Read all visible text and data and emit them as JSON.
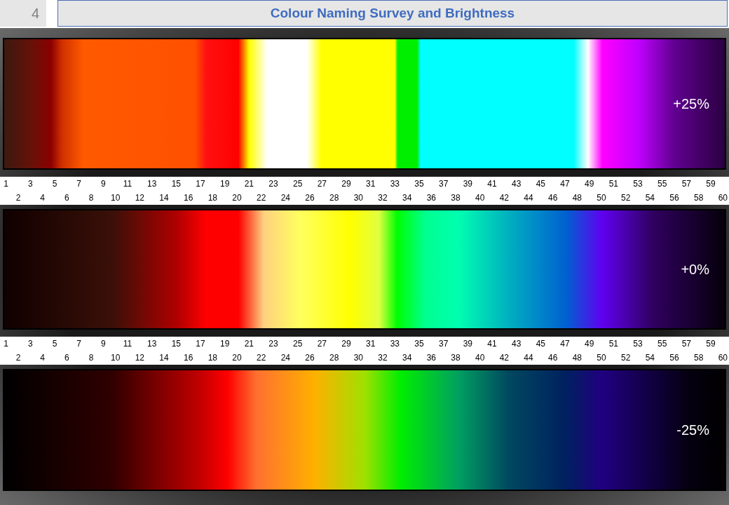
{
  "header": {
    "page_number": "4",
    "title": "Colour Naming Survey and Brightness"
  },
  "bands": [
    {
      "kind": "bright",
      "label": "+25%"
    },
    {
      "kind": "normal",
      "label": "+0%"
    },
    {
      "kind": "dark",
      "label": "-25%"
    }
  ],
  "scales": [
    {
      "ticks": [
        "1",
        "2",
        "3",
        "4",
        "5",
        "6",
        "7",
        "8",
        "9",
        "10",
        "11",
        "12",
        "13",
        "14",
        "15",
        "16",
        "17",
        "18",
        "19",
        "20",
        "21",
        "22",
        "23",
        "24",
        "25",
        "26",
        "27",
        "28",
        "29",
        "30",
        "31",
        "32",
        "33",
        "34",
        "35",
        "36",
        "37",
        "38",
        "39",
        "40",
        "41",
        "42",
        "43",
        "44",
        "45",
        "46",
        "47",
        "48",
        "49",
        "50",
        "51",
        "52",
        "53",
        "54",
        "55",
        "56",
        "57",
        "58",
        "59",
        "60"
      ]
    },
    {
      "ticks": [
        "1",
        "2",
        "3",
        "4",
        "5",
        "6",
        "7",
        "8",
        "9",
        "10",
        "11",
        "12",
        "13",
        "14",
        "15",
        "16",
        "17",
        "18",
        "19",
        "20",
        "21",
        "22",
        "23",
        "24",
        "25",
        "26",
        "27",
        "28",
        "29",
        "30",
        "31",
        "32",
        "33",
        "34",
        "35",
        "36",
        "37",
        "38",
        "39",
        "40",
        "41",
        "42",
        "43",
        "44",
        "45",
        "46",
        "47",
        "48",
        "49",
        "50",
        "51",
        "52",
        "53",
        "54",
        "55",
        "56",
        "57",
        "58",
        "59",
        "60"
      ]
    }
  ]
}
